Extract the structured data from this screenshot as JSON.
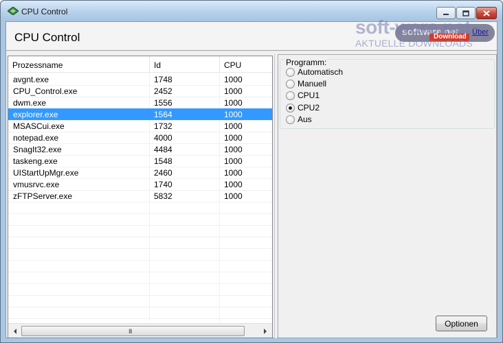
{
  "window": {
    "title": "CPU Control",
    "header_title": "CPU Control"
  },
  "watermark": {
    "main": "soft-ware.net",
    "sub": "AKTUELLE DOWNLOADS",
    "pill": "software.net",
    "badge": "Download",
    "link": "Über"
  },
  "table": {
    "columns": [
      "Prozessname",
      "Id",
      "CPU"
    ],
    "selected_index": 3,
    "rows": [
      {
        "name": "avgnt.exe",
        "id": "1748",
        "cpu": "1000"
      },
      {
        "name": "CPU_Control.exe",
        "id": "2452",
        "cpu": "1000"
      },
      {
        "name": "dwm.exe",
        "id": "1556",
        "cpu": "1000"
      },
      {
        "name": "explorer.exe",
        "id": "1564",
        "cpu": "1000"
      },
      {
        "name": "MSASCui.exe",
        "id": "1732",
        "cpu": "1000"
      },
      {
        "name": "notepad.exe",
        "id": "4000",
        "cpu": "1000"
      },
      {
        "name": "SnagIt32.exe",
        "id": "4484",
        "cpu": "1000"
      },
      {
        "name": "taskeng.exe",
        "id": "1548",
        "cpu": "1000"
      },
      {
        "name": "UIStartUpMgr.exe",
        "id": "2460",
        "cpu": "1000"
      },
      {
        "name": "vmusrvc.exe",
        "id": "1740",
        "cpu": "1000"
      },
      {
        "name": "zFTPServer.exe",
        "id": "5832",
        "cpu": "1000"
      }
    ]
  },
  "program_group": {
    "label": "Programm:",
    "selected": "CPU2",
    "options": [
      "Automatisch",
      "Manuell",
      "CPU1",
      "CPU2",
      "Aus"
    ]
  },
  "buttons": {
    "options": "Optionen"
  },
  "scrollbar": {
    "grip": "III"
  },
  "colors": {
    "selection": "#3399ff",
    "title_gradient_top": "#dceaf7",
    "close_button": "#c6473a"
  }
}
